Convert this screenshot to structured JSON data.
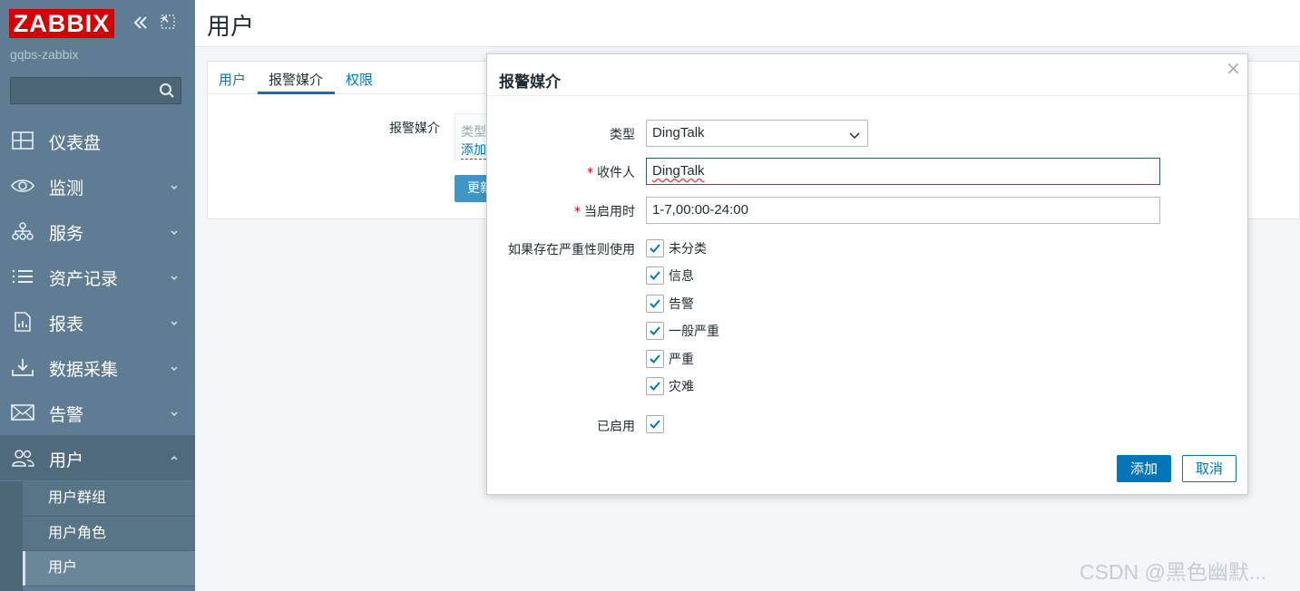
{
  "app": {
    "logo": "ZABBIX",
    "hostname": "gqbs-zabbix"
  },
  "search": {
    "value": "",
    "placeholder": ""
  },
  "menu": [
    {
      "label": "仪表盘",
      "icon": "dashboard-icon",
      "expandable": false
    },
    {
      "label": "监测",
      "icon": "eye-icon",
      "expandable": true
    },
    {
      "label": "服务",
      "icon": "services-icon",
      "expandable": true
    },
    {
      "label": "资产记录",
      "icon": "list-icon",
      "expandable": true
    },
    {
      "label": "报表",
      "icon": "report-icon",
      "expandable": true
    },
    {
      "label": "数据采集",
      "icon": "download-icon",
      "expandable": true
    },
    {
      "label": "告警",
      "icon": "envelope-icon",
      "expandable": true
    },
    {
      "label": "用户",
      "icon": "users-icon",
      "expandable": true,
      "expanded": true
    }
  ],
  "submenu": [
    {
      "label": "用户群组"
    },
    {
      "label": "用户角色"
    },
    {
      "label": "用户",
      "current": true
    }
  ],
  "page": {
    "title": "用户"
  },
  "tabs": [
    {
      "label": "用户"
    },
    {
      "label": "报警媒介",
      "active": true
    },
    {
      "label": "权限"
    }
  ],
  "media_section": {
    "label": "报警媒介",
    "column_type": "类型",
    "add_link": "添加",
    "update_button": "更新"
  },
  "dialog": {
    "title": "报警媒介",
    "close_symbol": "×",
    "type_label": "类型",
    "type_value": "DingTalk",
    "recipient_label": "收件人",
    "recipient_value": "DingTalk",
    "when_active_label": "当启用时",
    "when_active_value": "1-7,00:00-24:00",
    "severity_label": "如果存在严重性则使用",
    "severities": [
      {
        "label": "未分类",
        "checked": true
      },
      {
        "label": "信息",
        "checked": true
      },
      {
        "label": "告警",
        "checked": true
      },
      {
        "label": "一般严重",
        "checked": true
      },
      {
        "label": "严重",
        "checked": true
      },
      {
        "label": "灾难",
        "checked": true
      }
    ],
    "enabled_label": "已启用",
    "enabled_checked": true,
    "add_button": "添加",
    "cancel_button": "取消",
    "required_mark": "*"
  },
  "watermark": "CSDN @黑色幽默..."
}
